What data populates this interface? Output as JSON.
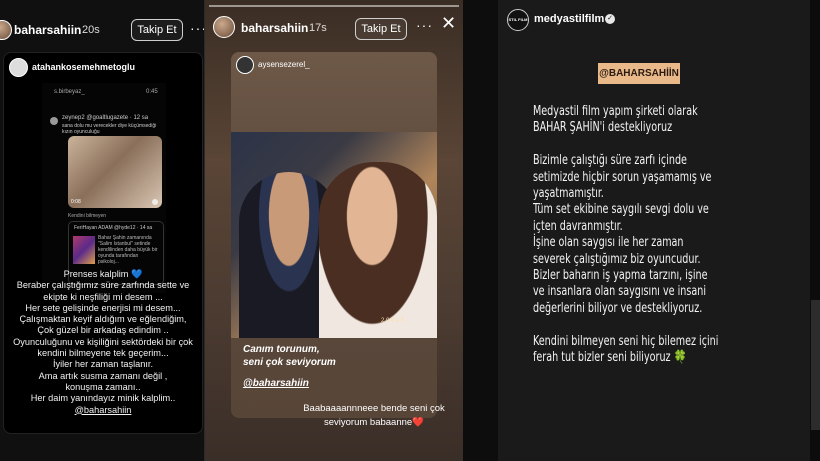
{
  "panel1": {
    "header": {
      "username": "baharsahiin",
      "time": "20s",
      "follow_label": "Takip Et"
    },
    "repost_user": "atahankosemehmetoglu",
    "phone_status": {
      "left": "s.birbeyaz_",
      "right": "0:45"
    },
    "comment1": {
      "user": "zeynep2 @goaltlugazete · 12 sa",
      "text": "sana dolu mu verecekler diye küçümsediği kızın oyunculuğu"
    },
    "video_time": "0:08",
    "caption_small": "Kendini bilmeyen",
    "comment2": {
      "user": "FeriHayan ADAM @hyde12 · 14 sa",
      "text": "Bahar Şahin zamanında \"Salim Istanbul\" setinde kendilinden daha büyük bir oyunda tarafından psikoloj..."
    },
    "message": [
      "Prenses kalplim 💙",
      "Beraber çalıştığımız süre zarfında sette ve",
      "ekipte ki neşfiliği mi desem ...",
      "Her sete gelişinde enerjisi mi desem...",
      "Çalışmaktan keyif aldığım ve eğlendiğim,",
      "Çok güzel bir arkadaş edindim ..",
      "Oyunculuğunu ve kişiliğini sektördeki bir çok",
      "kendini bilmeyene tek geçerim...",
      "İyiler her zaman taşlanır.",
      "Ama artık susma zamanı değil ,",
      "konuşma zamanı..",
      "Her daim yanındayız minik kalplim..",
      "@baharsahiin"
    ]
  },
  "panel2": {
    "header": {
      "username": "baharsahiin",
      "time": "17s",
      "follow_label": "Takip Et"
    },
    "repost_user": "aysensezerel_",
    "photo_timestamp": "2 0 4 1 5",
    "caption": {
      "line1": "Canım torunum,",
      "line2": "seni çok seviyorum",
      "mention": "@baharsahiin"
    },
    "reply": {
      "line1": "Baabaaaannneee bende seni çok",
      "line2": "seviyorum babaanne❤️"
    }
  },
  "panel3": {
    "header": {
      "username": "medyastilfilm",
      "logo": "STIL FILM"
    },
    "tag": "@BAHARSAHİİN",
    "lines": [
      "Medyastil film yapım şirketi olarak",
      "BAHAR ŞAHİN'i destekliyoruz",
      "",
      "Bizimle çalıştığı süre zarfı içinde",
      "setimizde hiçbir sorun yaşamamış ve",
      "yaşatmamıştır.",
      "Tüm set ekibine saygılı sevgi dolu ve",
      "içten davranmıştır.",
      "İşine olan saygısı ile her zaman",
      "severek çalıştığımız biz oyuncudur.",
      "Bizler baharın iş yapma tarzını, işine",
      "ve insanlara olan saygısını ve insani",
      "değerlerini biliyor ve destekliyoruz.",
      "",
      "Kendini bilmeyen seni hiç bilemez içini",
      "ferah tut bizler seni biliyoruz 🍀"
    ]
  },
  "colors": {
    "tag_bg": "#e9b98a",
    "tag_text": "#2a1a10",
    "mention": "#ffffff"
  }
}
